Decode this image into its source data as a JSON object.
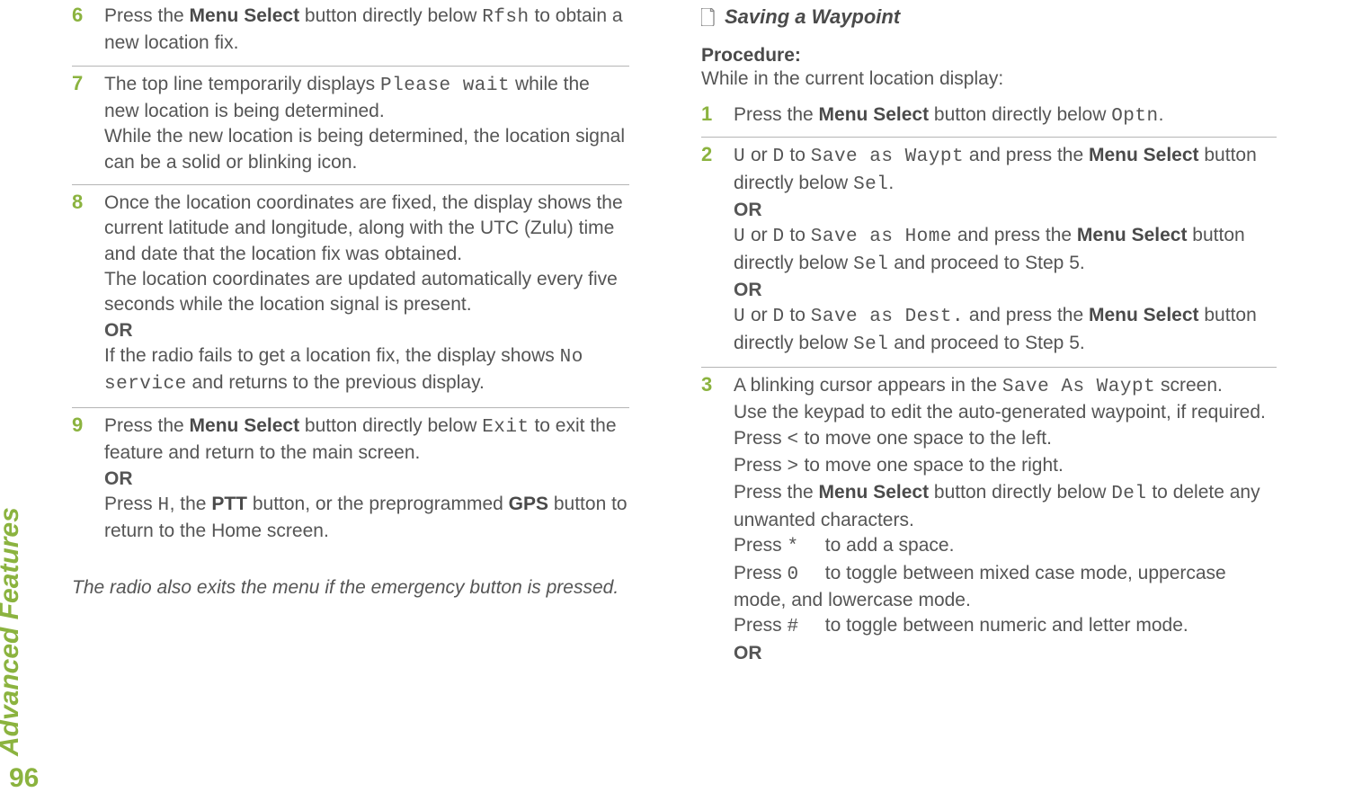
{
  "sidebar": {
    "label": "Advanced Features",
    "page_number": "96"
  },
  "left_column": {
    "steps": [
      {
        "num": "6",
        "body_html": "Press the <b>Menu Select</b> button directly below <span class='mono'>Rfsh</span> to obtain a new location fix."
      },
      {
        "num": "7",
        "body_html": "The top line temporarily displays <span class='mono'>Please wait</span> while the new location is being determined.<br>While the new location is being determined, the location signal can be a solid or blinking icon."
      },
      {
        "num": "8",
        "body_html": "Once the location coordinates are fixed, the display shows the current latitude and longitude, along with the UTC (Zulu) time and date that the location fix was obtained.<br>The location coordinates are updated automatically every five seconds while the location signal is present.<br><span class='or-label'>OR</span><br>If the radio fails to get a location fix, the display shows <span class='mono'>No service</span> and returns to the previous display."
      },
      {
        "num": "9",
        "body_html": "Press the <b>Menu Select</b> button directly below <span class='mono'>Exit</span> to exit the feature and return to the main screen.<br><span class='or-label'>OR</span><br>Press <span class='mono'>H</span>, the <b>PTT</b> button, or the preprogrammed <b>GPS</b> button to return to the Home screen."
      }
    ],
    "note": "The radio also exits the menu if the emergency button is pressed."
  },
  "right_column": {
    "heading": "Saving a Waypoint",
    "procedure_label": "Procedure:",
    "procedure_sub": "While in the current location display:",
    "steps": [
      {
        "num": "1",
        "body_html": "Press the <b>Menu Select</b> button directly below <span class='mono'>Optn</span>."
      },
      {
        "num": "2",
        "body_html": "<span class='mono'>U</span> or <span class='mono'>D</span> to <span class='mono'>Save as Waypt</span> and press the <b>Menu Select</b> button directly below <span class='mono'>Sel</span>.<br><span class='or-label'>OR</span><br><span class='mono'>U</span> or <span class='mono'>D</span> to <span class='mono'>Save as Home</span> and press the <b>Menu Select</b> button directly below <span class='mono'>Sel</span> and proceed to Step 5.<br><span class='or-label'>OR</span><br><span class='mono'>U</span> or <span class='mono'>D</span> to <span class='mono'>Save as Dest.</span> and press the <b>Menu Select</b> button directly below <span class='mono'>Sel</span> and proceed to Step 5."
      },
      {
        "num": "3",
        "body_html": "A blinking cursor appears in the <span class='mono'>Save As Waypt</span> screen.<br>Use the keypad to edit the auto-generated waypoint, if required.<br>Press <span class='mono'>&lt;</span> to move one space to the left.<br>Press <span class='mono'>&gt;</span> to move one space to the right.<br>Press the <b>Menu Select</b> button directly below <span class='mono'>Del</span> to delete any unwanted characters.<br>Press <span class='mono'>*</span>&nbsp;&nbsp;&nbsp;&nbsp; to add a space.<br>Press <span class='mono'>0</span>&nbsp;&nbsp;&nbsp;&nbsp; to toggle between mixed case mode, uppercase mode, and lowercase mode.<br>Press <span class='mono'>#</span>&nbsp;&nbsp;&nbsp;&nbsp; to toggle between numeric and letter mode.<br><span class='or-label'>OR</span>"
      }
    ]
  }
}
